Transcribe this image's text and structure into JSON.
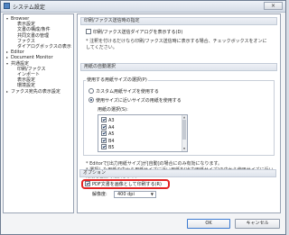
{
  "window": {
    "title": "システム設定",
    "close_glyph": "×"
  },
  "tree": {
    "items": [
      {
        "label": "Browser",
        "toggle": "▾",
        "level": 0
      },
      {
        "label": "表示設定",
        "toggle": "",
        "level": 1
      },
      {
        "label": "文書の構成/条件",
        "toggle": "",
        "level": 1
      },
      {
        "label": "共同文書の管理",
        "toggle": "",
        "level": 1
      },
      {
        "label": "ファクス",
        "toggle": "",
        "level": 1
      },
      {
        "label": "ダイアログボックスの表示",
        "toggle": "",
        "level": 1
      },
      {
        "label": "Editor",
        "toggle": "▸",
        "level": 0
      },
      {
        "label": "Document Monitor",
        "toggle": "▸",
        "level": 0
      },
      {
        "label": "共通設定",
        "toggle": "▾",
        "level": 0
      },
      {
        "label": "印刷/ファクス",
        "toggle": "",
        "level": 1
      },
      {
        "label": "インポート",
        "toggle": "",
        "level": 1
      },
      {
        "label": "表示設定",
        "toggle": "",
        "level": 1
      },
      {
        "label": "環境設定",
        "toggle": "",
        "level": 1
      },
      {
        "label": "ファクス宛先の表示設定",
        "toggle": "▸",
        "level": 0
      }
    ]
  },
  "section_fax": {
    "header": "印刷/ファクス送信時の指定",
    "checkbox_label": "印刷/ファクス送信ダイアログを表示する(D)",
    "checked": false,
    "note_line1": "* 注釈を付けるだけなら印刷/ファクス送信時に表示する場合、チェックボックスをオンに",
    "note_line2": "  してください。"
  },
  "section_paper": {
    "header": "用紙の自動選択",
    "group_label": "使用する用紙サイズの選択(P)",
    "radio_custom": "カスタム用紙サイズを使用する",
    "radio_selected": "使用サイズに近いサイズの用紙を使用する",
    "sizes_label": "用紙の選択(S):",
    "selected_radio": "radio_selected",
    "sizes": [
      {
        "label": "A3",
        "checked": true
      },
      {
        "label": "A4",
        "checked": true
      },
      {
        "label": "A5",
        "checked": true
      },
      {
        "label": "B4",
        "checked": true
      },
      {
        "label": "B5",
        "checked": true
      }
    ],
    "note_line1": "* Editorで[出力用紙サイズ]が[自動]の場合にのみ有効になります。",
    "note_line2": "* 選択した用紙の中から用紙サイズに近い用紙を[出力用紙サイズ]の中から使用サイズに近い",
    "note_line3": "  用紙を自動で選択します。"
  },
  "section_options": {
    "header": "オプション",
    "pdf_checkbox_label": "PDF文書を画像として印刷する(R)",
    "pdf_checked": true,
    "resolution_label": "解像度:",
    "resolution_value": "400 dpi"
  },
  "buttons": {
    "ok": "OK",
    "cancel": "キャンセル"
  },
  "colors": {
    "highlight": "#e32424",
    "accent": "#3d7bd1"
  }
}
